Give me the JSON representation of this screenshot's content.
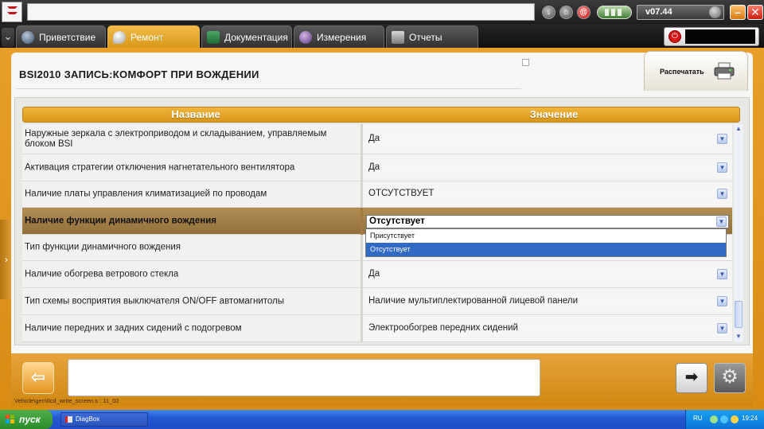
{
  "app": {
    "version": "v07.44"
  },
  "tabs": [
    {
      "label": "Приветствие",
      "active": false,
      "icon": "globe-icon"
    },
    {
      "label": "Ремонт",
      "active": true,
      "icon": "magnifier-icon"
    },
    {
      "label": "Документация",
      "active": false,
      "icon": "book-icon"
    },
    {
      "label": "Измерения",
      "active": false,
      "icon": "signal-icon"
    },
    {
      "label": "Отчеты",
      "active": false,
      "icon": "document-icon"
    }
  ],
  "page": {
    "title": "BSI2010  ЗАПИСЬ:КОМФОРТ ПРИ ВОЖДЕНИИ",
    "print_label": "Распечатать"
  },
  "table": {
    "headers": {
      "name": "Название",
      "value": "Значение"
    },
    "rows": [
      {
        "name": "Наружные зеркала с электроприводом и складыванием, управляемым блоком BSI",
        "value": "Да"
      },
      {
        "name": "Активация стратегии отключения нагнетательного вентилятора",
        "value": "Да"
      },
      {
        "name": "Наличие платы управления климатизацией по проводам",
        "value": "ОТСУТСТВУЕТ"
      },
      {
        "name": "Наличие функции динамичного вождения",
        "value": "Отсутствует"
      },
      {
        "name": "Тип функции динамичного вождения",
        "value": ""
      },
      {
        "name": "Наличие обогрева ветрового стекла",
        "value": "Да"
      },
      {
        "name": "Тип схемы восприятия выключателя ON/OFF автомагнитолы",
        "value": "Наличие мультиплектированной лицевой панели"
      },
      {
        "name": "Наличие передних и задних сидений с подогревом",
        "value": "Электрообогрев передних сидений"
      }
    ],
    "dropdown_options": [
      "Присутствует",
      "Отсутствует"
    ],
    "dropdown_highlighted": "Отсутствует"
  },
  "footer": {
    "path_text": "Vehicle\\gen\\tlcd_write_screen.s : 11_02"
  },
  "taskbar": {
    "start_label": "пуск",
    "task_label": "DiagBox",
    "language": "RU",
    "clock": "19:24"
  },
  "colors": {
    "accent_orange": "#e79f28",
    "selected_row": "#a47e45",
    "dropdown_highlight": "#316ac5"
  }
}
